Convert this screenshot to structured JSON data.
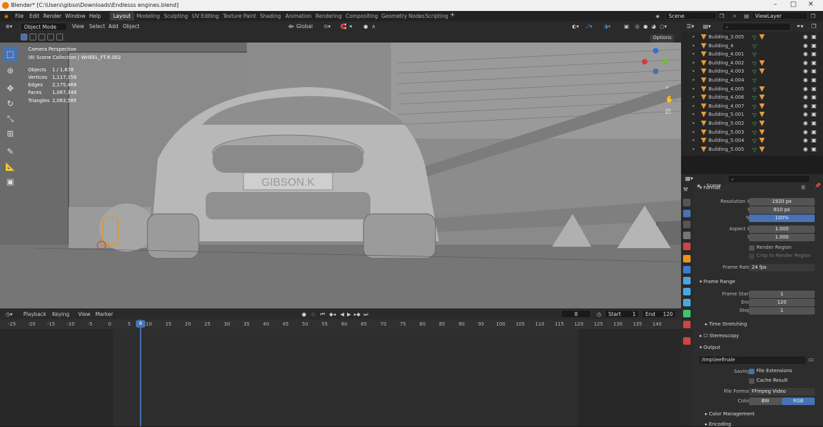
{
  "title": "Blender* [C:\\Users\\gibso\\Downloads\\Endlesss engines.blend]",
  "menu": [
    "File",
    "Edit",
    "Render",
    "Window",
    "Help"
  ],
  "workspaces": [
    "Layout",
    "Modeling",
    "Sculpting",
    "UV Editing",
    "Texture Paint",
    "Shading",
    "Animation",
    "Rendering",
    "Compositing",
    "Geometry Nodes",
    "Scripting"
  ],
  "scene_name": "Scene",
  "view_layer": "ViewLayer",
  "viewport": {
    "mode": "Object Mode",
    "menus": [
      "View",
      "Select",
      "Add",
      "Object"
    ],
    "transform": "Global",
    "options": "Options",
    "camera_label": "Camera Perspective",
    "collection_label": "(8) Scene Collection | WHEEL_FT.R.002",
    "stats": [
      {
        "k": "Objects",
        "v": "1 / 1,678"
      },
      {
        "k": "Vertices",
        "v": "1,117,159"
      },
      {
        "k": "Edges",
        "v": "2,175,469"
      },
      {
        "k": "Faces",
        "v": "1,067,349"
      },
      {
        "k": "Triangles",
        "v": "2,063,585"
      }
    ],
    "plate_text": "GIBSON.K"
  },
  "timeline": {
    "menus": [
      "Playback",
      "Keying",
      "View",
      "Marker"
    ],
    "current_frame": "8",
    "start_label": "Start",
    "start": "1",
    "end_label": "End",
    "end": "120",
    "ticks": [
      "-25",
      "-20",
      "-15",
      "-10",
      "-5",
      "0",
      "5",
      "8",
      "10",
      "15",
      "20",
      "25",
      "30",
      "35",
      "40",
      "45",
      "50",
      "55",
      "60",
      "65",
      "70",
      "75",
      "80",
      "85",
      "90",
      "95",
      "100",
      "105",
      "110",
      "115",
      "120",
      "125",
      "130",
      "135",
      "140"
    ]
  },
  "outliner": {
    "items": [
      "Building_3.005",
      "Building_4",
      "Building_4.001",
      "Building_4.002",
      "Building_4.003",
      "Building_4.004",
      "Building_4.005",
      "Building_4.006",
      "Building_4.007",
      "Building_5.001",
      "Building_5.002",
      "Building_5.003",
      "Building_5.004",
      "Building_5.005"
    ]
  },
  "properties": {
    "scene": "Scene",
    "format": {
      "title": "Format",
      "res_x_label": "Resolution X",
      "res_x": "1920 px",
      "res_y_label": "Y",
      "res_y": "810 px",
      "pct_label": "%",
      "pct": "100%",
      "aspect_x_label": "Aspect X",
      "aspect_x": "1.000",
      "aspect_y_label": "Y",
      "aspect_y": "1.000",
      "render_region": "Render Region",
      "crop": "Crop to Render Region",
      "fps_label": "Frame Rate",
      "fps": "24 fps"
    },
    "frame_range": {
      "title": "Frame Range",
      "start_label": "Frame Start",
      "start": "1",
      "end_label": "End",
      "end": "120",
      "step_label": "Step",
      "step": "1"
    },
    "time_stretching": "Time Stretching",
    "stereoscopy": "Stereoscopy",
    "output": {
      "title": "Output",
      "path": "/tmp\\leefinale",
      "saving_label": "Saving",
      "file_ext": "File Extensions",
      "cache": "Cache Result",
      "format_label": "File Format",
      "format": "FFmpeg Video",
      "color_label": "Color",
      "bw": "BW",
      "rgb": "RGB"
    },
    "color_management": "Color Management",
    "encoding": "Encoding"
  }
}
